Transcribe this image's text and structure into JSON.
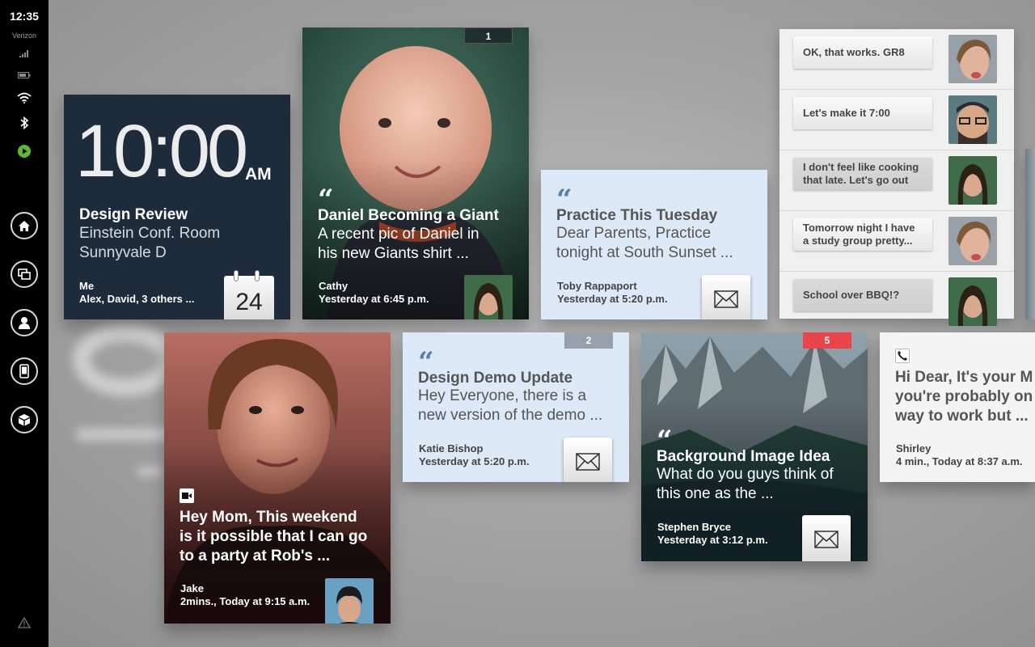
{
  "status": {
    "time": "12:35",
    "carrier": "Verizon"
  },
  "nav": [
    "home-icon",
    "windows-icon",
    "contact-icon",
    "phone-icon",
    "box-icon",
    "warning-icon"
  ],
  "calendar": {
    "time": "10:00",
    "ampm": "AM",
    "title": "Design Review",
    "location_line1": "Einstein Conf. Room",
    "location_line2": "Sunnyvale D",
    "attendee_me": "Me",
    "attendees": "Alex, David,  3 others ...",
    "day": "24"
  },
  "card_daniel": {
    "badge": "1",
    "title": "Daniel Becoming a Giant",
    "excerpt": "A recent pic of Daniel in\nhis new Giants shirt ...",
    "sender": "Cathy",
    "meta": "Yesterday at 6:45 p.m."
  },
  "card_practice": {
    "title": "Practice This Tuesday",
    "excerpt": "Dear Parents, Practice\ntonight at South Sunset ...",
    "sender": "Toby Rappaport",
    "meta": "Yesterday at 5:20 p.m."
  },
  "card_jake": {
    "message": "Hey Mom, This weekend\nis it possible that I can go\nto a party at Rob's ...",
    "sender": "Jake",
    "meta": "2mins., Today at 9:15 a.m."
  },
  "card_demo": {
    "badge": "2",
    "title": "Design Demo Update",
    "excerpt": "Hey Everyone, there is a\nnew version of the demo ...",
    "sender": "Katie Bishop",
    "meta": "Yesterday at 5:20 p.m."
  },
  "card_background": {
    "badge": "5",
    "title": "Background Image Idea",
    "excerpt": "What do you guys think of\nthis one as the ...",
    "sender": "Stephen Bryce",
    "meta": "Yesterday at 3:12 p.m."
  },
  "card_voicemail": {
    "message": "Hi Dear, It's your M\nyou're probably on\nway to work but ...",
    "sender": "Shirley",
    "meta": "4 min., Today at 8:37 a.m."
  },
  "chat": [
    {
      "text": "OK, that works. GR8"
    },
    {
      "text": "Let's make it 7:00"
    },
    {
      "text": "I don't feel like cooking that late. Let's go out"
    },
    {
      "text": "Tomorrow night I have a study group pretty..."
    },
    {
      "text": "School over BBQ!?"
    }
  ],
  "colors": {
    "sidebar": "#000000",
    "calendar_bg": "#1e2b3b",
    "light_card": "#dde9f7",
    "badge_grey": "#97a1ab",
    "badge_red": "#e8444a",
    "status_green": "#5cb82e",
    "quote_blue": "#5a7fa6"
  }
}
